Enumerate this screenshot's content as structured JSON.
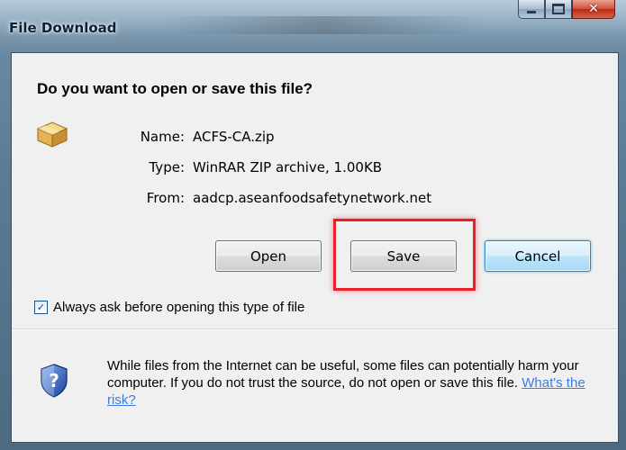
{
  "window": {
    "title": "File Download"
  },
  "dialog": {
    "heading": "Do you want to open or save this file?",
    "file": {
      "name_label": "Name:",
      "name_value": "ACFS-CA.zip",
      "type_label": "Type:",
      "type_value": "WinRAR ZIP archive, 1.00KB",
      "from_label": "From:",
      "from_value": "aadcp.aseanfoodsafetynetwork.net",
      "icon": "package-box-icon"
    },
    "buttons": {
      "open": "Open",
      "save": "Save",
      "cancel": "Cancel"
    },
    "checkbox": {
      "label": "Always ask before opening this type of file",
      "checked": true
    },
    "warning": {
      "text": "While files from the Internet can be useful, some files can potentially harm your computer. If you do not trust the source, do not open or save this file.",
      "link": "What's the risk?",
      "icon": "security-shield-icon"
    }
  },
  "colors": {
    "highlight": "#e8202a",
    "link": "#3b7ce3",
    "default_button": "#a7d9f5"
  }
}
